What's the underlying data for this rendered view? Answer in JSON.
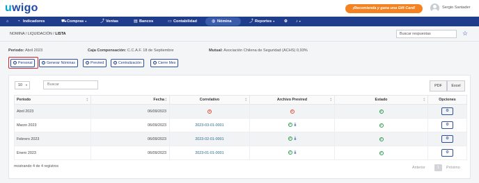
{
  "brand": {
    "logo_u": "u",
    "logo_rest": "wigo"
  },
  "promo": "¡Recomienda y gana una Gift Card!",
  "user": {
    "name": "Sergio Santader"
  },
  "nav": [
    {
      "label": "Indicadores",
      "icon": "speedometer-icon"
    },
    {
      "label": "Compras",
      "icon": "cart-icon"
    },
    {
      "label": "Ventas",
      "icon": "chart-line-icon"
    },
    {
      "label": "Bancos",
      "icon": "bank-icon"
    },
    {
      "label": "Contabilidad",
      "icon": "document-icon"
    },
    {
      "label": "Nómina",
      "icon": "globe-icon",
      "active": true
    },
    {
      "label": "Reportes",
      "icon": "chart-line-icon"
    }
  ],
  "breadcrumb": {
    "a": "NOMINA",
    "b": "LIQUIDACIÓN",
    "c": "LISTA"
  },
  "search": {
    "placeholder": "Buscar respuestas"
  },
  "info": {
    "periodo_label": "Periodo:",
    "periodo_value": "Abril 2023",
    "caja_label": "Caja Compensación:",
    "caja_value": "C.C.A.F. 18 de Septiembre",
    "mutual_label": "Mutual:",
    "mutual_value": "Asociación Chilena de Seguridad (ACHS) 0,93%"
  },
  "actions": [
    "Personal",
    "Generar Nóminas",
    "Previred",
    "Centralización",
    "Cierre Mes"
  ],
  "table_controls": {
    "page_size": "10",
    "search_placeholder": "Buscar",
    "pdf": "PDF",
    "excel": "Excel"
  },
  "columns": [
    "Periodo",
    "Fecha",
    "Correlativo",
    "Archivo Previred",
    "Estado",
    "Opciones"
  ],
  "rows": [
    {
      "periodo": "Abril 2023",
      "fecha": "06/09/2023",
      "correlativo": "",
      "previred": "pending",
      "estado": "ok"
    },
    {
      "periodo": "Marzo 2023",
      "fecha": "06/09/2023",
      "correlativo": "2023-03-01-0001",
      "previred": "ok-download",
      "estado": "ok"
    },
    {
      "periodo": "Febrero 2023",
      "fecha": "06/09/2023",
      "correlativo": "2023-02-01-0001",
      "previred": "ok-download",
      "estado": "ok"
    },
    {
      "periodo": "Enero 2023",
      "fecha": "06/09/2023",
      "correlativo": "2023-01-01-0001",
      "previred": "ok-download",
      "estado": "ok"
    }
  ],
  "footer": {
    "info": "mostrando 4 de 4 registros",
    "prev": "Anterior",
    "page": "1",
    "next": "Próximo"
  },
  "colors": {
    "nav": "#1f3d8a",
    "accent": "#f58220",
    "highlight": "#d0262c",
    "ok": "#2e9e4f",
    "error": "#e0533a"
  }
}
